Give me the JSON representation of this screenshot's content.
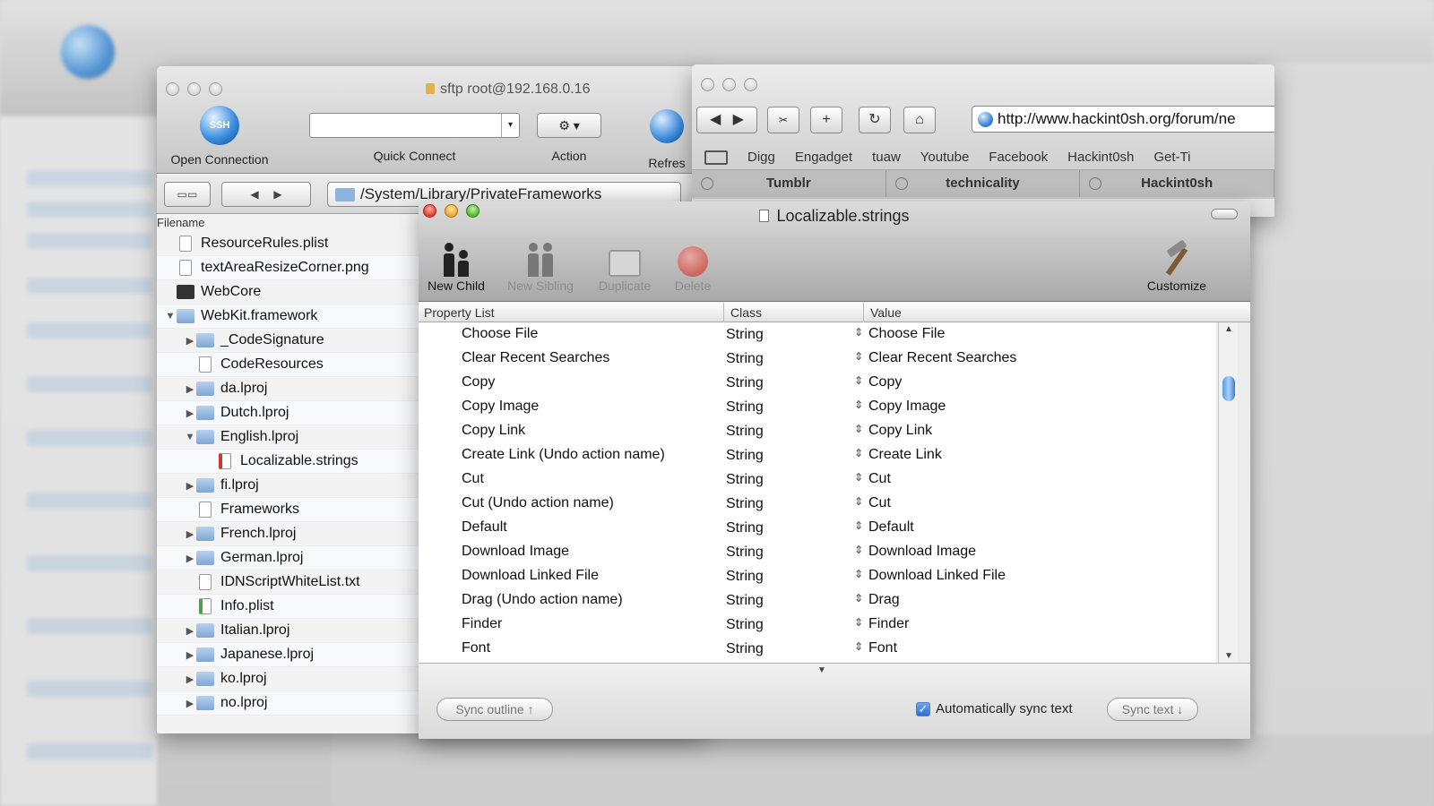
{
  "sftp": {
    "title": "sftp root@192.168.0.16",
    "toolbar": {
      "open_connection": "Open Connection",
      "quick_connect": "Quick Connect",
      "action": "Action",
      "refresh": "Refres"
    },
    "path": "/System/Library/PrivateFrameworks",
    "column_filename": "Filename",
    "files": [
      {
        "name": "ResourceRules.plist",
        "indent": 0,
        "disclosure": "",
        "icon": "doc"
      },
      {
        "name": "textAreaResizeCorner.png",
        "indent": 0,
        "disclosure": "",
        "icon": "doc"
      },
      {
        "name": "WebCore",
        "indent": 0,
        "disclosure": "",
        "icon": "dark"
      },
      {
        "name": "WebKit.framework",
        "indent": 0,
        "disclosure": "▼",
        "icon": "folder"
      },
      {
        "name": "_CodeSignature",
        "indent": 1,
        "disclosure": "▶",
        "icon": "folder"
      },
      {
        "name": "CodeResources",
        "indent": 1,
        "disclosure": "",
        "icon": "doc"
      },
      {
        "name": "da.lproj",
        "indent": 1,
        "disclosure": "▶",
        "icon": "folder"
      },
      {
        "name": "Dutch.lproj",
        "indent": 1,
        "disclosure": "▶",
        "icon": "folder"
      },
      {
        "name": "English.lproj",
        "indent": 1,
        "disclosure": "▼",
        "icon": "folder"
      },
      {
        "name": "Localizable.strings",
        "indent": 2,
        "disclosure": "",
        "icon": "red"
      },
      {
        "name": "fi.lproj",
        "indent": 1,
        "disclosure": "▶",
        "icon": "folder"
      },
      {
        "name": "Frameworks",
        "indent": 1,
        "disclosure": "",
        "icon": "doc"
      },
      {
        "name": "French.lproj",
        "indent": 1,
        "disclosure": "▶",
        "icon": "folder"
      },
      {
        "name": "German.lproj",
        "indent": 1,
        "disclosure": "▶",
        "icon": "folder"
      },
      {
        "name": "IDNScriptWhiteList.txt",
        "indent": 1,
        "disclosure": "",
        "icon": "doc"
      },
      {
        "name": "Info.plist",
        "indent": 1,
        "disclosure": "",
        "icon": "green"
      },
      {
        "name": "Italian.lproj",
        "indent": 1,
        "disclosure": "▶",
        "icon": "folder"
      },
      {
        "name": "Japanese.lproj",
        "indent": 1,
        "disclosure": "▶",
        "icon": "folder"
      },
      {
        "name": "ko.lproj",
        "indent": 1,
        "disclosure": "▶",
        "icon": "folder"
      },
      {
        "name": "no.lproj",
        "indent": 1,
        "disclosure": "▶",
        "icon": "folder"
      }
    ]
  },
  "browser": {
    "url": "http://www.hackint0sh.org/forum/ne",
    "bookmarks": [
      "Digg",
      "Engadget",
      "tuaw",
      "Youtube",
      "Facebook",
      "Hackint0sh",
      "Get-Ti"
    ],
    "tabs": [
      "Tumblr",
      "technicality",
      "Hackint0sh"
    ]
  },
  "plist": {
    "title": "Localizable.strings",
    "toolbar": {
      "new_child": "New Child",
      "new_sibling": "New Sibling",
      "duplicate": "Duplicate",
      "delete": "Delete",
      "customize": "Customize"
    },
    "columns": {
      "property": "Property List",
      "class": "Class",
      "value": "Value"
    },
    "rows": [
      {
        "key": "Choose File",
        "class": "String",
        "value": "Choose File"
      },
      {
        "key": "Clear Recent Searches",
        "class": "String",
        "value": "Clear Recent Searches"
      },
      {
        "key": "Copy",
        "class": "String",
        "value": "Copy"
      },
      {
        "key": "Copy Image",
        "class": "String",
        "value": "Copy Image"
      },
      {
        "key": "Copy Link",
        "class": "String",
        "value": "Copy Link"
      },
      {
        "key": "Create Link (Undo action name)",
        "class": "String",
        "value": "Create Link"
      },
      {
        "key": "Cut",
        "class": "String",
        "value": "Cut"
      },
      {
        "key": "Cut (Undo action name)",
        "class": "String",
        "value": "Cut"
      },
      {
        "key": "Default",
        "class": "String",
        "value": "Default"
      },
      {
        "key": "Download Image",
        "class": "String",
        "value": "Download Image"
      },
      {
        "key": "Download Linked File",
        "class": "String",
        "value": "Download Linked File"
      },
      {
        "key": "Drag (Undo action name)",
        "class": "String",
        "value": "Drag"
      },
      {
        "key": "Finder",
        "class": "String",
        "value": "Finder"
      },
      {
        "key": "Font",
        "class": "String",
        "value": "Font"
      }
    ],
    "footer": {
      "sync_outline": "Sync outline ↑",
      "auto_sync": "Automatically sync text",
      "sync_text": "Sync text ↓"
    }
  }
}
